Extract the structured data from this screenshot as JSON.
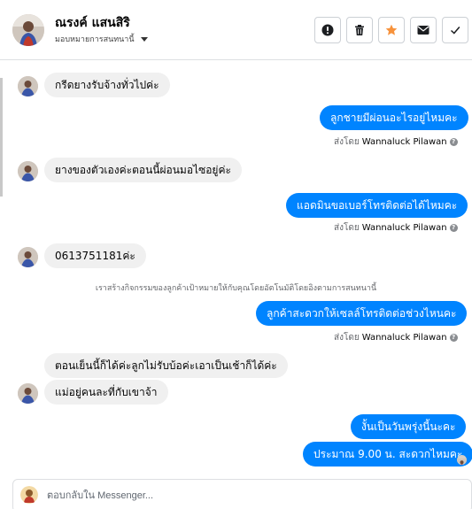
{
  "header": {
    "contact_name": "ณรงค์ แสนสิริ",
    "assign_label": "มอบหมายการสนทนานี้",
    "actions": [
      {
        "name": "report-button",
        "icon": "exclamation-circle-icon"
      },
      {
        "name": "delete-button",
        "icon": "trash-icon"
      },
      {
        "name": "star-button",
        "icon": "star-icon",
        "color": "#f7923b"
      },
      {
        "name": "mark-unread-button",
        "icon": "envelope-icon"
      },
      {
        "name": "mark-done-button",
        "icon": "checkmark-icon"
      }
    ]
  },
  "messages": [
    {
      "dir": "in",
      "text": "กรีดยางรับจ้างทั่วไปค่ะ"
    },
    {
      "dir": "out",
      "text": "ลูกชายมีผ่อนอะไรอยู่ไหมคะ",
      "sent_by_prefix": "ส่งโดย",
      "sent_by_name": "Wannaluck Pilawan"
    },
    {
      "dir": "in",
      "text": "ยางของตัวเองค่ะตอนนี้ผ่อนมอไซอยู่ค่ะ"
    },
    {
      "dir": "out",
      "text": "แอดมินขอเบอร์โทรติดต่อได้ไหมคะ",
      "sent_by_prefix": "ส่งโดย",
      "sent_by_name": "Wannaluck Pilawan"
    },
    {
      "dir": "in",
      "text": "0613751181ค่ะ"
    },
    {
      "dir": "system",
      "text": "เราสร้างกิจกรรมของลูกค้าเป้าหมายให้กับคุณโดยอัตโนมัติโดยอิงตามการสนทนานี้"
    },
    {
      "dir": "out",
      "text": "ลูกค้าสะดวกให้เซลล์โทรติดต่อช่วงไหนคะ",
      "sent_by_prefix": "ส่งโดย",
      "sent_by_name": "Wannaluck Pilawan"
    },
    {
      "dir": "in",
      "text": "ตอนเย็นนี้ก็ได้ค่ะลูกไม่รับบ้อค่ะเอาเป็นเช้าก็ได้ค่ะ"
    },
    {
      "dir": "in",
      "text": "แม่อยู่คนละที่กับเขาจ้า"
    },
    {
      "dir": "out",
      "text": "งั้นเป็นวันพรุ่งนี้นะคะ"
    },
    {
      "dir": "out",
      "text": "ประมาณ 9.00 น. สะดวกไหมคะ"
    }
  ],
  "composer": {
    "placeholder": "ตอบกลับใน Messenger..."
  },
  "colors": {
    "outgoing_bubble": "#0084ff",
    "incoming_bubble": "#f0f0f0",
    "star": "#f7923b"
  }
}
